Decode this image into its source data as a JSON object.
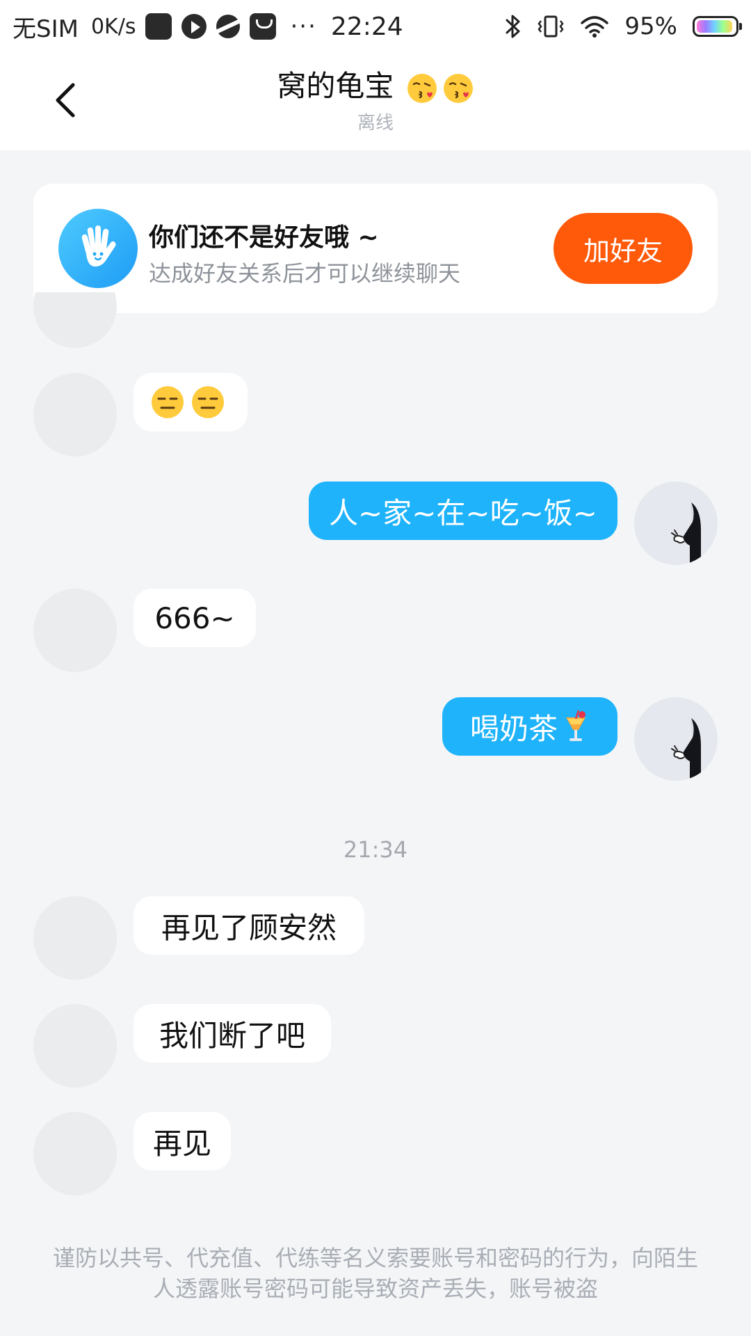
{
  "status_bar": {
    "carrier": "无SIM",
    "speed": "0K/s",
    "dots": "···",
    "time": "22:24",
    "battery": "95%",
    "battery_level": 0.95,
    "icons": [
      "app-square-icon",
      "play-icon",
      "planet-icon",
      "mail-icon",
      "bluetooth-icon",
      "vibrate-icon",
      "wifi-icon",
      "battery-icon"
    ]
  },
  "header": {
    "title": "窝的龟宝",
    "title_emojis": [
      "kissing-face-icon",
      "kissing-face-icon"
    ],
    "status": "离线"
  },
  "friend_notice": {
    "title": "你们还不是好友哦 ~",
    "description": "达成好友关系后才可以继续聊天",
    "button_label": "加好友",
    "icon": "waving-hand-icon"
  },
  "messages": [
    {
      "side": "left",
      "emojis": [
        "expressionless-face-icon",
        "expressionless-face-icon"
      ]
    },
    {
      "side": "right",
      "text": "人~家~在~吃~饭~"
    },
    {
      "side": "left",
      "text": "666~"
    },
    {
      "side": "right",
      "text": "喝奶茶",
      "emoji": "tropical-drink-icon"
    },
    {
      "side": "left",
      "text": "再见了顾安然"
    },
    {
      "side": "left",
      "text": "我们断了吧"
    },
    {
      "side": "left",
      "text": "再见"
    }
  ],
  "timestamp": "21:34",
  "security_notice": "谨防以共号、代充值、代练等名义索要账号和密码的行为，向陌生人透露账号密码可能导致资产丢失，账号被盗",
  "colors": {
    "background": "#F4F5F7",
    "outgoing_bubble": "#1EB3FA",
    "incoming_bubble": "#FFFFFF",
    "add_friend_button": "#FF5A0A",
    "notice_icon": "#26A9F7",
    "muted_text": "#A4A8AE"
  }
}
